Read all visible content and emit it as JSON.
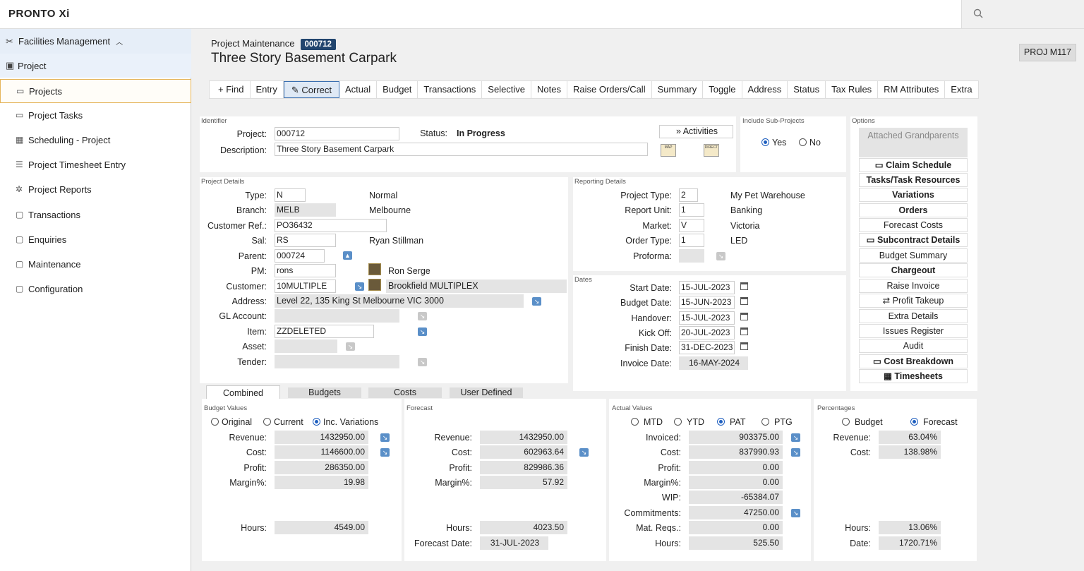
{
  "app": {
    "logo": "PRONTO Xi"
  },
  "sidebar": {
    "module": "Facilities Management",
    "section": "Project",
    "items": [
      {
        "label": "Projects",
        "icon": "list-icon"
      },
      {
        "label": "Project Tasks",
        "icon": "list-icon"
      },
      {
        "label": "Scheduling - Project",
        "icon": "grid-icon"
      },
      {
        "label": "Project Timesheet Entry",
        "icon": "lines-icon"
      },
      {
        "label": "Project Reports",
        "icon": "report-icon"
      },
      {
        "label": "Transactions",
        "icon": "folder-icon"
      },
      {
        "label": "Enquiries",
        "icon": "folder-icon"
      },
      {
        "label": "Maintenance",
        "icon": "folder-icon"
      },
      {
        "label": "Configuration",
        "icon": "folder-gear-icon"
      }
    ]
  },
  "header": {
    "crumb": "Project Maintenance",
    "badge": "000712",
    "title": "Three Story Basement Carpark",
    "program": "PROJ M117"
  },
  "toolbar": [
    "Find",
    "Entry",
    "Correct",
    "Actual",
    "Budget",
    "Transactions",
    "Selective",
    "Notes",
    "Raise Orders/Call",
    "Summary",
    "Toggle",
    "Address",
    "Status",
    "Tax Rules",
    "RM Attributes",
    "Extra"
  ],
  "identifier": {
    "title": "Identifier",
    "project_label": "Project:",
    "project": "000712",
    "status_label": "Status:",
    "status": "In Progress",
    "desc_label": "Description:",
    "desc": "Three Story Basement Carpark",
    "activities": "Activities",
    "map_icon_text": "MAP",
    "direct_icon_text": "DIRECT"
  },
  "subprojects": {
    "title": "Include Sub-Projects",
    "yes": "Yes",
    "no": "No"
  },
  "details": {
    "title": "Project Details",
    "rows": [
      {
        "label": "Type:",
        "value": "N",
        "desc": "Normal"
      },
      {
        "label": "Branch:",
        "value": "MELB",
        "desc": "Melbourne"
      },
      {
        "label": "Customer Ref.:",
        "value": "PO36432",
        "desc": ""
      },
      {
        "label": "Sal:",
        "value": "RS",
        "desc": "Ryan Stillman"
      },
      {
        "label": "Parent:",
        "value": "000724",
        "desc": ""
      },
      {
        "label": "PM:",
        "value": "rons",
        "desc": "Ron Serge"
      },
      {
        "label": "Customer:",
        "value": "10MULTIPLE",
        "desc": "Brookfield MULTIPLEX"
      },
      {
        "label": "Address:",
        "value": "Level 22, 135 King St Melbourne VIC  3000",
        "desc": ""
      },
      {
        "label": "GL Account:",
        "value": "",
        "desc": ""
      },
      {
        "label": "Item:",
        "value": "ZZDELETED",
        "desc": ""
      },
      {
        "label": "Asset:",
        "value": "",
        "desc": ""
      },
      {
        "label": "Tender:",
        "value": "",
        "desc": ""
      }
    ]
  },
  "reporting": {
    "title": "Reporting Details",
    "rows": [
      {
        "label": "Project Type:",
        "value": "2",
        "desc": "My Pet Warehouse"
      },
      {
        "label": "Report Unit:",
        "value": "1",
        "desc": "Banking"
      },
      {
        "label": "Market:",
        "value": "V",
        "desc": "Victoria"
      },
      {
        "label": "Order Type:",
        "value": "1",
        "desc": "LED"
      },
      {
        "label": "Proforma:",
        "value": "",
        "desc": ""
      }
    ]
  },
  "dates": {
    "title": "Dates",
    "rows": [
      {
        "label": "Start Date:",
        "value": "15-JUL-2023"
      },
      {
        "label": "Budget Date:",
        "value": "15-JUN-2023"
      },
      {
        "label": "Handover:",
        "value": "15-JUL-2023"
      },
      {
        "label": "Kick Off:",
        "value": "20-JUL-2023"
      },
      {
        "label": "Finish Date:",
        "value": "31-DEC-2023"
      },
      {
        "label": "Invoice Date:",
        "value": "16-MAY-2024"
      }
    ]
  },
  "options": {
    "title": "Options",
    "items": [
      {
        "label": "Attached Grandparents",
        "style": "dis"
      },
      {
        "label": "Claim Schedule",
        "style": "b",
        "icon": "folder"
      },
      {
        "label": "Tasks/Task Resources",
        "style": "b"
      },
      {
        "label": "Variations",
        "style": "b"
      },
      {
        "label": "Orders",
        "style": "b"
      },
      {
        "label": "Forecast Costs",
        "style": ""
      },
      {
        "label": "Subcontract Details",
        "style": "b",
        "icon": "folder"
      },
      {
        "label": "Budget Summary",
        "style": ""
      },
      {
        "label": "Chargeout",
        "style": "b"
      },
      {
        "label": "Raise Invoice",
        "style": ""
      },
      {
        "label": "Profit Takeup",
        "style": "",
        "icon": "arrows"
      },
      {
        "label": "Extra Details",
        "style": ""
      },
      {
        "label": "Issues Register",
        "style": ""
      },
      {
        "label": "Audit",
        "style": ""
      },
      {
        "label": "Cost Breakdown",
        "style": "b",
        "icon": "folder"
      },
      {
        "label": "Timesheets",
        "style": "b",
        "icon": "table"
      }
    ]
  },
  "tabs": [
    "Combined",
    "Budgets",
    "Costs",
    "User Defined"
  ],
  "budget": {
    "title": "Budget Values",
    "radios": [
      "Original",
      "Current",
      "Inc. Variations"
    ],
    "revenue_label": "Revenue:",
    "revenue": "1432950.00",
    "cost_label": "Cost:",
    "cost": "1146600.00",
    "profit_label": "Profit:",
    "profit": "286350.00",
    "margin_label": "Margin%:",
    "margin": "19.98",
    "hours_label": "Hours:",
    "hours": "4549.00"
  },
  "forecast": {
    "title": "Forecast",
    "revenue_label": "Revenue:",
    "revenue": "1432950.00",
    "cost_label": "Cost:",
    "cost": "602963.64",
    "profit_label": "Profit:",
    "profit": "829986.36",
    "margin_label": "Margin%:",
    "margin": "57.92",
    "hours_label": "Hours:",
    "hours": "4023.50",
    "date_label": "Forecast Date:",
    "date": "31-JUL-2023"
  },
  "actual": {
    "title": "Actual Values",
    "radios": [
      "MTD",
      "YTD",
      "PAT",
      "PTG"
    ],
    "invoiced_label": "Invoiced:",
    "invoiced": "903375.00",
    "cost_label": "Cost:",
    "cost": "837990.93",
    "profit_label": "Profit:",
    "profit": "0.00",
    "margin_label": "Margin%:",
    "margin": "0.00",
    "wip_label": "WIP:",
    "wip": "-65384.07",
    "commit_label": "Commitments:",
    "commit": "47250.00",
    "matreq_label": "Mat. Reqs.:",
    "matreq": "0.00",
    "hours_label": "Hours:",
    "hours": "525.50"
  },
  "percentages": {
    "title": "Percentages",
    "radios": [
      "Budget",
      "Forecast"
    ],
    "revenue_label": "Revenue:",
    "revenue": "63.04%",
    "cost_label": "Cost:",
    "cost": "138.98%",
    "hours_label": "Hours:",
    "hours": "13.06%",
    "date_label": "Date:",
    "date": "1720.71%"
  }
}
